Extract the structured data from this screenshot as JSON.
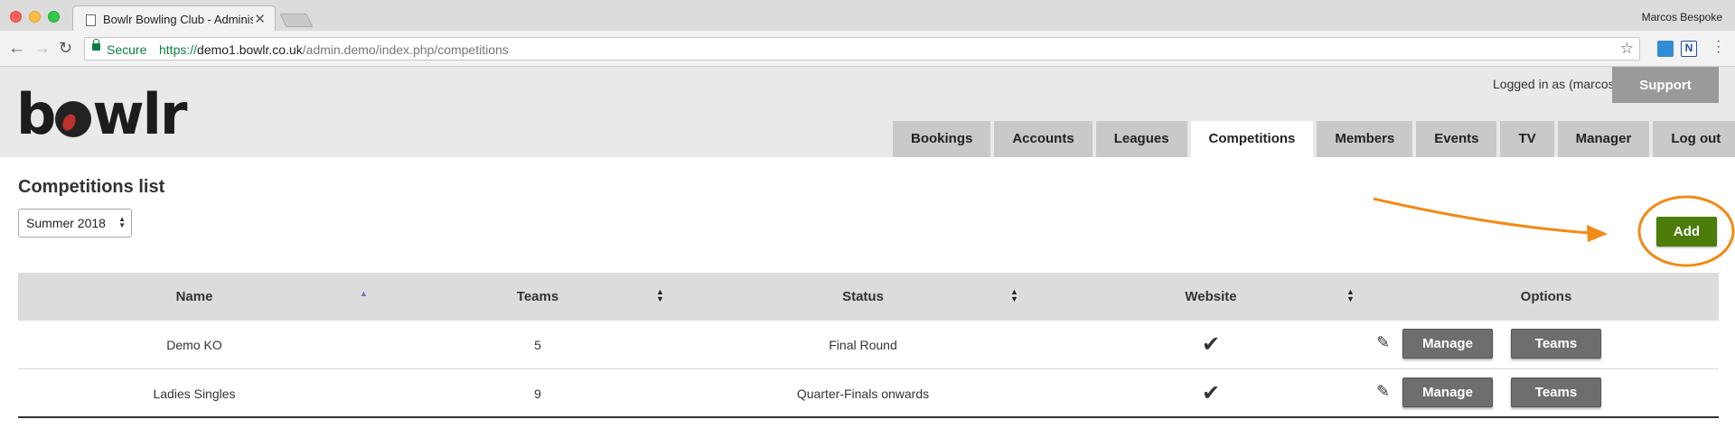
{
  "browser": {
    "tab_title": "Bowlr Bowling Club - Administ",
    "tab_close": "✕",
    "profile_name": "Marcos Bespoke",
    "secure_label": "Secure",
    "url_scheme": "https://",
    "url_host": "demo1.bowlr.co.uk",
    "url_path": "/admin.demo/index.php/competitions"
  },
  "header": {
    "logo_left": "b",
    "logo_right": "wlr",
    "login_text": "Logged in as (marcos)",
    "support_label": "Support",
    "nav": [
      {
        "label": "Bookings",
        "active": false
      },
      {
        "label": "Accounts",
        "active": false
      },
      {
        "label": "Leagues",
        "active": false
      },
      {
        "label": "Competitions",
        "active": true
      },
      {
        "label": "Members",
        "active": false
      },
      {
        "label": "Events",
        "active": false
      },
      {
        "label": "TV",
        "active": false
      },
      {
        "label": "Manager",
        "active": false
      },
      {
        "label": "Log out",
        "active": false
      }
    ]
  },
  "page": {
    "title": "Competitions list",
    "season_selected": "Summer 2018",
    "add_label": "Add"
  },
  "table": {
    "columns": [
      "Name",
      "Teams",
      "Status",
      "Website",
      "Options"
    ],
    "rows": [
      {
        "name": "Demo KO",
        "teams": "5",
        "status": "Final Round",
        "website": true,
        "manage": "Manage",
        "teams_btn": "Teams"
      },
      {
        "name": "Ladies Singles",
        "teams": "9",
        "status": "Quarter-Finals onwards",
        "website": true,
        "manage": "Manage",
        "teams_btn": "Teams"
      }
    ]
  },
  "colors": {
    "accent_green": "#4c7d0b",
    "annotation_orange": "#f28a16",
    "header_bg": "#e9e9e9"
  },
  "icons": {
    "website_check": "✔",
    "edit": "✎"
  }
}
